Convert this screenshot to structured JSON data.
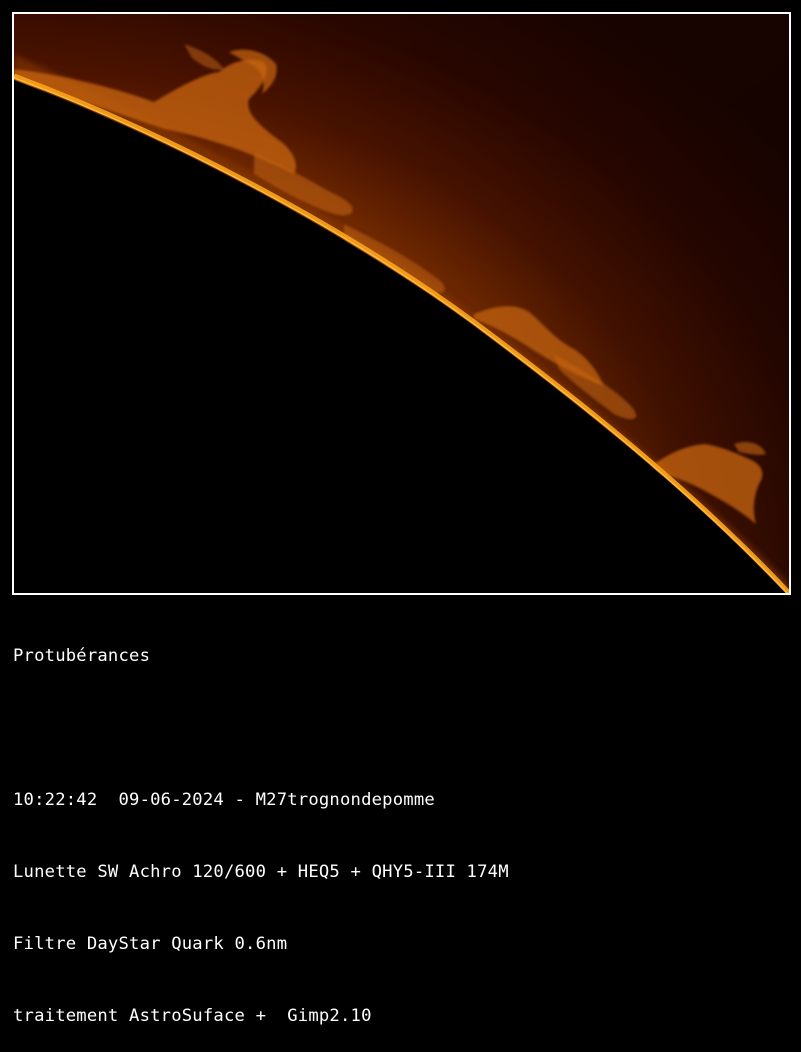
{
  "image": {
    "subject": "solar-limb-with-prominences",
    "colors": {
      "sky_dark": "#2a0600",
      "sky_mid": "#5a1600",
      "sky_glow": "#8a3400",
      "limb": "#f5a21a",
      "prominence": "#c96a10",
      "disk": "#000000",
      "frame_border": "#ffffff"
    }
  },
  "caption": {
    "title": "Protubérances",
    "datetime_line": "10:22:42  09-06-2024 - M27trognondepomme",
    "equipment_line": "Lunette SW Achro 120/600 + HEQ5 + QHY5-III 174M",
    "filter_line": "Filtre DayStar Quark 0.6nm",
    "processing_line": "traitement AstroSuface +  Gimp2.10"
  }
}
